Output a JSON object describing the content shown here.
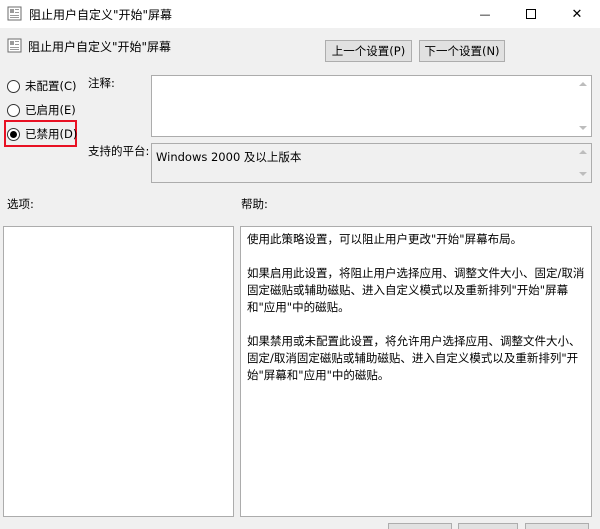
{
  "window": {
    "title": "阻止用户自定义\"开始\"屏幕",
    "minimize_glyph": "—",
    "close_glyph": "✕"
  },
  "header": {
    "policy_name": "阻止用户自定义\"开始\"屏幕",
    "prev_label": "上一个设置(P)",
    "next_label": "下一个设置(N)"
  },
  "options_state": {
    "not_configured": "未配置(C)",
    "enabled": "已启用(E)",
    "disabled": "已禁用(D)",
    "selected": "disabled"
  },
  "comment": {
    "label": "注释:",
    "value": ""
  },
  "platform": {
    "label": "支持的平台:",
    "value": "Windows 2000 及以上版本"
  },
  "options_panel": {
    "label": "选项:"
  },
  "help": {
    "label": "帮助:",
    "paragraphs": [
      "使用此策略设置，可以阻止用户更改\"开始\"屏幕布局。",
      "如果启用此设置，将阻止用户选择应用、调整文件大小、固定/取消固定磁贴或辅助磁贴、进入自定义模式以及重新排列\"开始\"屏幕和\"应用\"中的磁贴。",
      "如果禁用或未配置此设置，将允许用户选择应用、调整文件大小、固定/取消固定磁贴或辅助磁贴、进入自定义模式以及重新排列\"开始\"屏幕和\"应用\"中的磁贴。"
    ]
  },
  "colors": {
    "window_bg": "#f0f0f0",
    "highlight_frame": "#e81123",
    "button_face": "#e1e1e1"
  }
}
